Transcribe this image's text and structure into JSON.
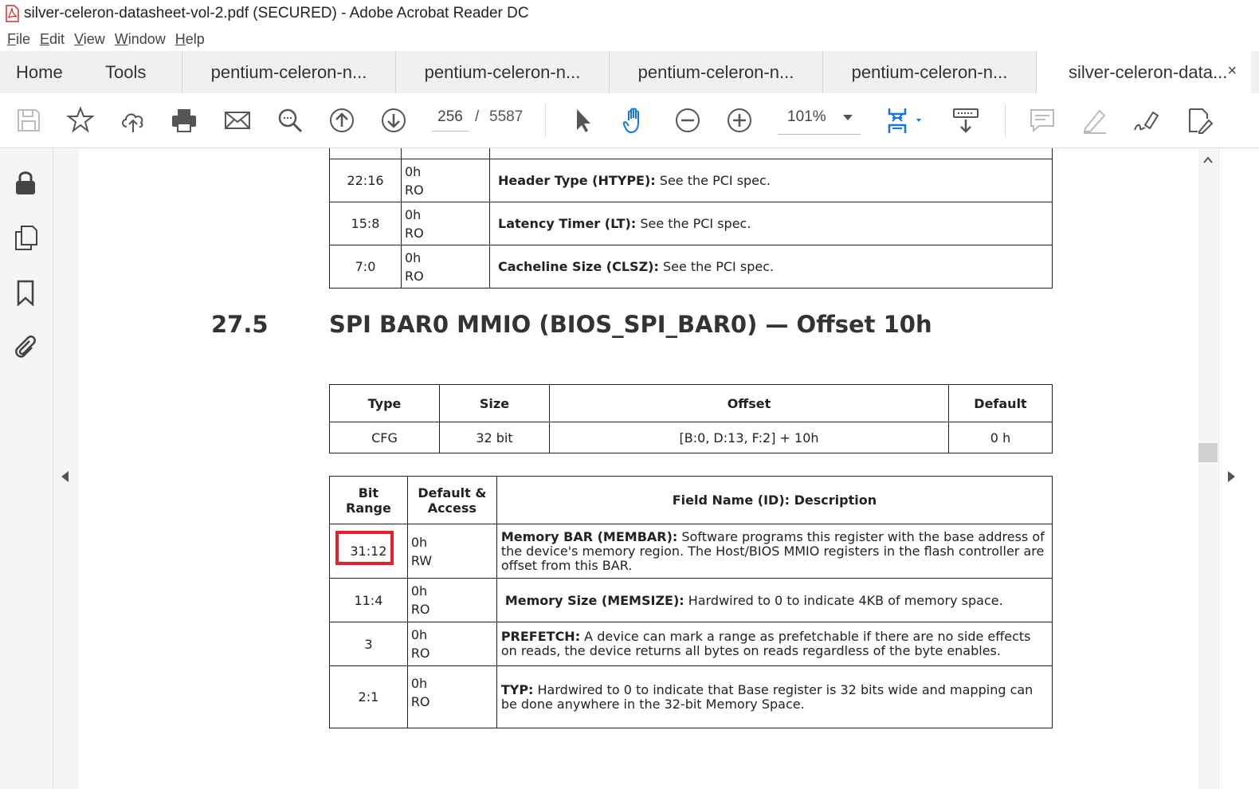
{
  "window": {
    "title": "silver-celeron-datasheet-vol-2.pdf (SECURED) - Adobe Acrobat Reader DC"
  },
  "menu": [
    "File",
    "Edit",
    "View",
    "Window",
    "Help"
  ],
  "tabs": {
    "home": "Home",
    "tools": "Tools",
    "docs": [
      "pentium-celeron-n...",
      "pentium-celeron-n...",
      "pentium-celeron-n...",
      "pentium-celeron-n..."
    ],
    "active": "silver-celeron-data...",
    "close": "×"
  },
  "toolbar": {
    "page_current": "256",
    "page_sep": "/",
    "page_total": "5587",
    "zoom": "101%"
  },
  "doc": {
    "top_table": [
      {
        "bits": "22:16",
        "default": "0h",
        "access": "RO",
        "name": "Header Type (HTYPE):",
        "desc": " See the PCI spec."
      },
      {
        "bits": "15:8",
        "default": "0h",
        "access": "RO",
        "name": "Latency Timer (LT):",
        "desc": " See the PCI spec."
      },
      {
        "bits": "7:0",
        "default": "0h",
        "access": "RO",
        "name": "Cacheline Size (CLSZ):",
        "desc": " See the PCI spec."
      }
    ],
    "section_number": "27.5",
    "section_title": "SPI BAR0 MMIO (BIOS_SPI_BAR0) — Offset 10h",
    "summary_headers": [
      "Type",
      "Size",
      "Offset",
      "Default"
    ],
    "summary_row": [
      "CFG",
      "32 bit",
      "[B:0, D:13, F:2] + 10h",
      "0 h"
    ],
    "field_headers": {
      "bit_range": "Bit Range",
      "default_access": "Default & Access",
      "field": "Field Name (ID): Description"
    },
    "fields": [
      {
        "bits": "31:12",
        "default": "0h",
        "access": "RW",
        "name": "Memory BAR (MEMBAR):",
        "desc": " Software programs this register with the base address of the device's memory region. The Host/BIOS MMIO registers in the flash controller are offset from this BAR."
      },
      {
        "bits": "11:4",
        "default": "0h",
        "access": "RO",
        "name": "Memory Size (MEMSIZE):",
        "desc": " Hardwired to 0 to indicate 4KB of memory space."
      },
      {
        "bits": "3",
        "default": "0h",
        "access": "RO",
        "name": "PREFETCH:",
        "desc": " A device can mark a range as prefetchable if there are no side effects on reads, the device returns all bytes on reads regardless of the byte enables."
      },
      {
        "bits": "2:1",
        "default": "0h",
        "access": "RO",
        "name": "TYP:",
        "desc": " Hardwired to 0 to indicate that Base register is 32 bits wide and mapping can be done anywhere in the 32-bit Memory Space."
      }
    ]
  },
  "colors": {
    "highlight": "#e8202a",
    "accent_blue": "#1473e6"
  }
}
